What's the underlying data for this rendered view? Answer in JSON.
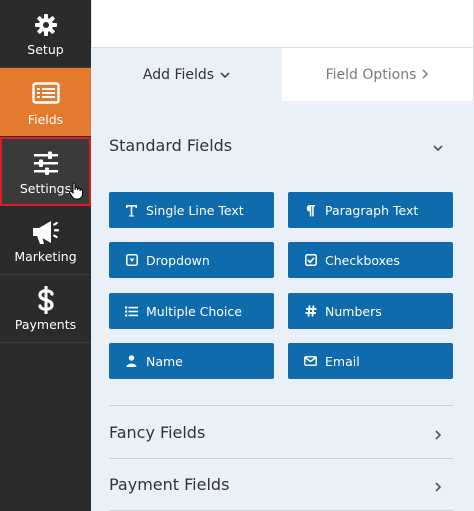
{
  "sidebar": {
    "items": [
      {
        "label": "Setup",
        "icon": "gear-icon"
      },
      {
        "label": "Fields",
        "icon": "list-icon"
      },
      {
        "label": "Settings",
        "icon": "sliders-icon"
      },
      {
        "label": "Marketing",
        "icon": "megaphone-icon"
      },
      {
        "label": "Payments",
        "icon": "dollar-icon"
      }
    ]
  },
  "tabs": {
    "add_fields": "Add Fields",
    "field_options": "Field Options"
  },
  "sections": {
    "standard": "Standard Fields",
    "fancy": "Fancy Fields",
    "payment": "Payment Fields"
  },
  "fields": [
    {
      "label": "Single Line Text",
      "icon": "text-icon"
    },
    {
      "label": "Paragraph Text",
      "icon": "paragraph-icon"
    },
    {
      "label": "Dropdown",
      "icon": "dropdown-icon"
    },
    {
      "label": "Checkboxes",
      "icon": "checkbox-icon"
    },
    {
      "label": "Multiple Choice",
      "icon": "list-bullets-icon"
    },
    {
      "label": "Numbers",
      "icon": "hash-icon"
    },
    {
      "label": "Name",
      "icon": "user-icon"
    },
    {
      "label": "Email",
      "icon": "envelope-icon"
    }
  ],
  "colors": {
    "sidebar_bg": "#2b2b2b",
    "active_item": "#e37a2d",
    "field_button": "#0f6bab",
    "panel_bg": "#e9f0f8",
    "highlight_border": "#d81e1e"
  }
}
